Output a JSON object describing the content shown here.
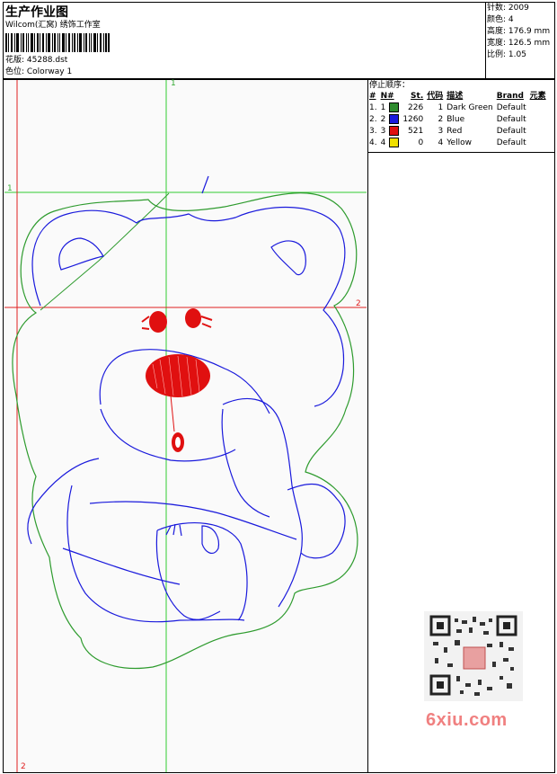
{
  "header": {
    "title": "生产作业图",
    "subtitle": "Wilcom(汇窝) 绣饰工作室",
    "design_label": "花版: 45288.dst",
    "colorway_label": "色位: Colorway 1"
  },
  "stats": [
    {
      "label": "针数",
      "value": "2009"
    },
    {
      "label": "颜色",
      "value": "4"
    },
    {
      "label": "高度",
      "value": "176.9 mm"
    },
    {
      "label": "宽度",
      "value": "126.5 mm"
    },
    {
      "label": "比例",
      "value": "1.05"
    }
  ],
  "stop_sequence": {
    "title": "停止顺序：",
    "headers": [
      "#",
      "N#",
      "St.",
      "代码",
      "描述",
      "Brand",
      "元素"
    ],
    "rows": [
      {
        "index": "1.",
        "n": "1",
        "color": "#2e8b2e",
        "stitches": "226",
        "code": "1",
        "description": "Dark Green",
        "brand": "Default"
      },
      {
        "index": "2.",
        "n": "2",
        "color": "#1a1adc",
        "stitches": "1260",
        "code": "2",
        "description": "Blue",
        "brand": "Default"
      },
      {
        "index": "3.",
        "n": "3",
        "color": "#e01010",
        "stitches": "521",
        "code": "3",
        "description": "Red",
        "brand": "Default"
      },
      {
        "index": "4.",
        "n": "4",
        "color": "#f0e000",
        "stitches": "0",
        "code": "4",
        "description": "Yellow",
        "brand": "Default"
      }
    ]
  },
  "axes": {
    "v1": "1",
    "h1": "1",
    "h2": "2",
    "v2": "2"
  },
  "watermark": "6xiu.com",
  "colors": {
    "green": "#2e9b2e",
    "blue": "#1a1adc",
    "red": "#e01010",
    "guide_green": "#33cc33",
    "guide_red": "#e02020"
  }
}
